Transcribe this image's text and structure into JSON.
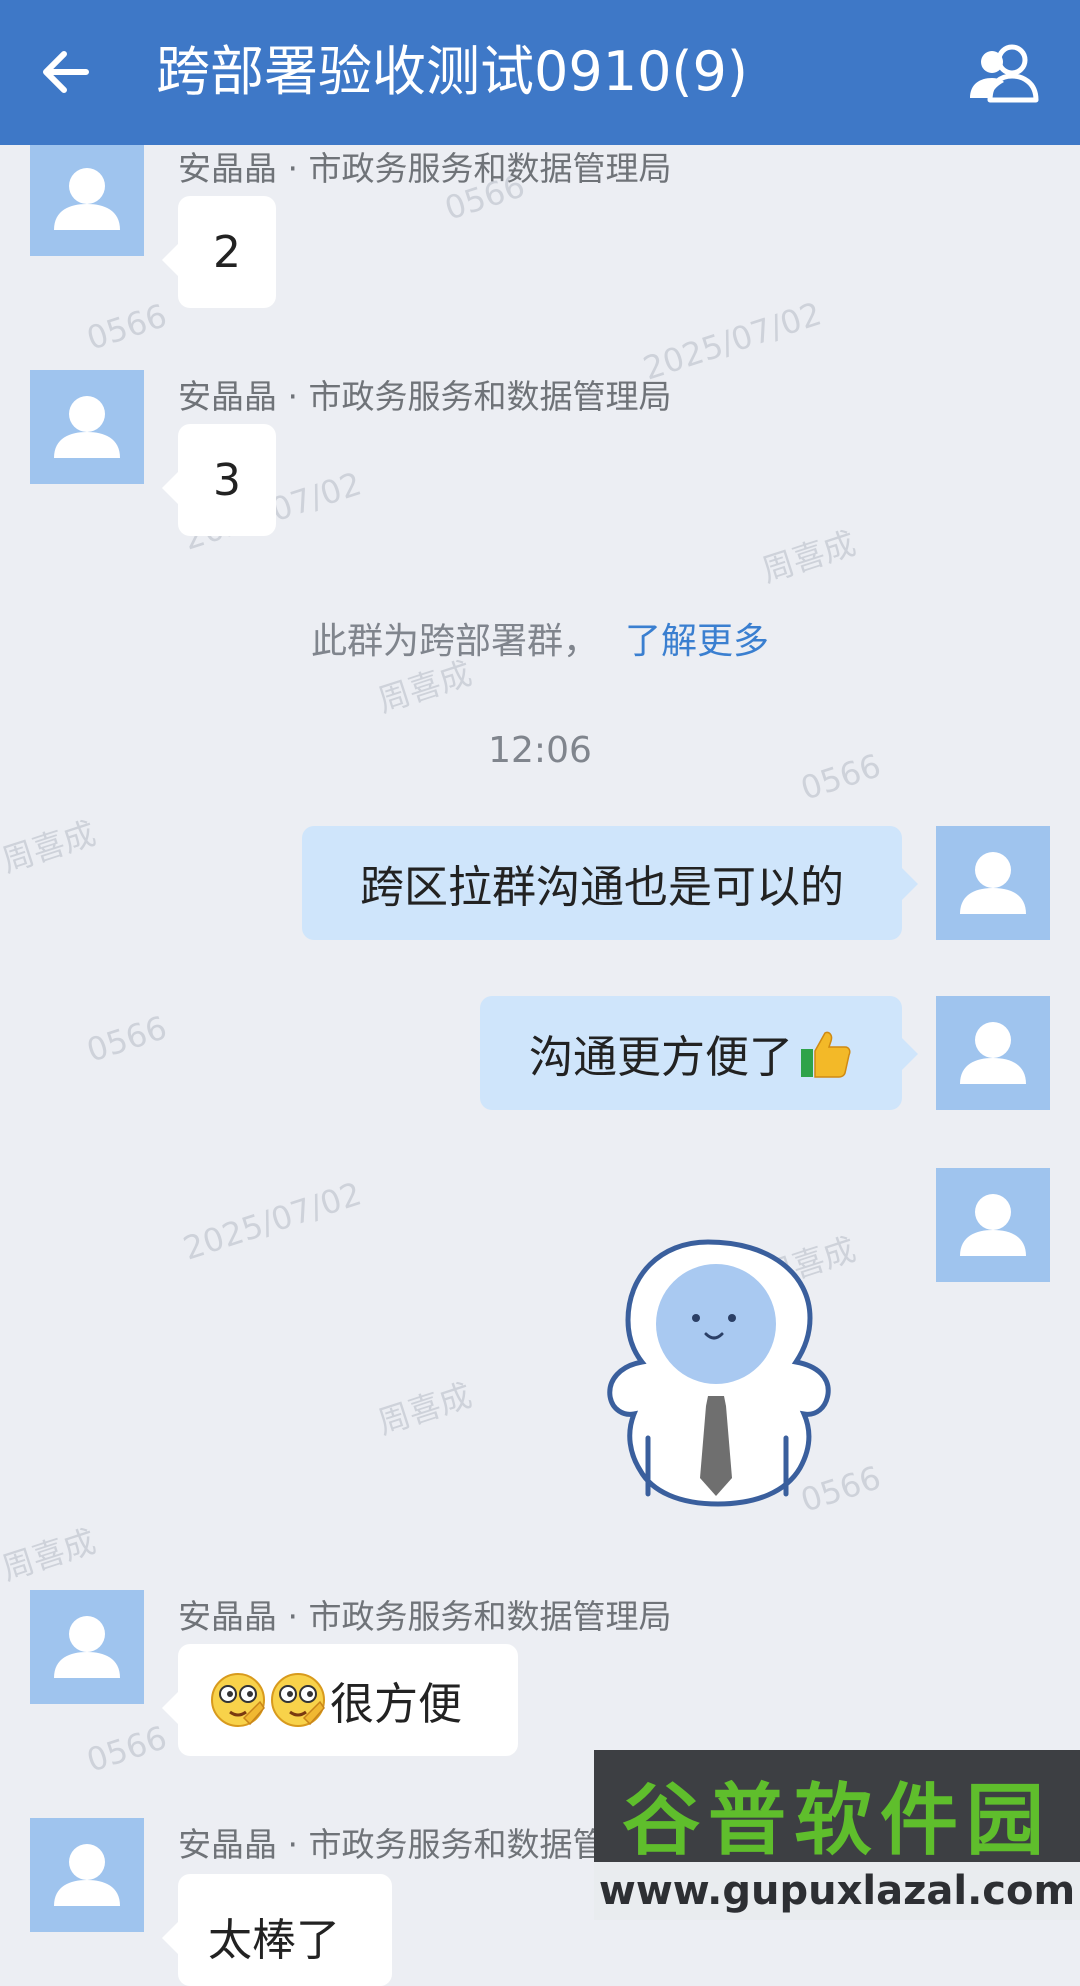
{
  "header": {
    "title": "跨部署验收测试0910(9)",
    "back_icon": "back-arrow-icon",
    "members_icon": "group-members-icon",
    "bg_color": "#3e78c7"
  },
  "watermarks": [
    "0566",
    "2025/07/02",
    "周喜成"
  ],
  "messages": [
    {
      "sender": "安晶晶 · 市政务服务和数据管理局",
      "text": "2"
    },
    {
      "sender": "安晶晶 · 市政务服务和数据管理局",
      "text": "3"
    },
    {
      "sender": "安晶晶 · 市政务服务和数据管理局",
      "text": "很方便",
      "emoji_count": 2
    },
    {
      "sender": "安晶晶 · 市政务服务和数据管理局",
      "text": "太棒了"
    }
  ],
  "system": {
    "notice": "此群为跨部署群，",
    "link": "了解更多",
    "time": "12:06"
  },
  "my_messages": [
    {
      "text": "跨区拉群沟通也是可以的"
    },
    {
      "text": "沟通更方便了",
      "emoji": "thumbs-up-icon"
    },
    {
      "sticker": "astronaut-sticker"
    }
  ],
  "site_watermark": {
    "top": "谷普软件园",
    "bottom": "www.gupuxlazal.com"
  }
}
